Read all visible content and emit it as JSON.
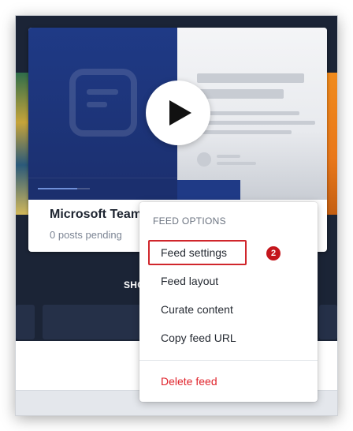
{
  "card": {
    "title": "Microsoft Teams",
    "subtitle": "0 posts pending"
  },
  "background": {
    "section_label": "SHOW"
  },
  "menu": {
    "header": "FEED OPTIONS",
    "items": [
      {
        "label": "Feed settings"
      },
      {
        "label": "Feed layout"
      },
      {
        "label": "Curate content"
      },
      {
        "label": "Copy feed URL"
      }
    ],
    "delete_label": "Delete feed"
  },
  "annotation": {
    "step_number": "2",
    "highlight_color": "#d0262c"
  },
  "icons": {
    "play": "play-icon",
    "logo": "app-logo-icon"
  },
  "colors": {
    "accent_blue": "#1f3a86",
    "danger": "#e0242c",
    "page_dark": "#1b2436"
  }
}
